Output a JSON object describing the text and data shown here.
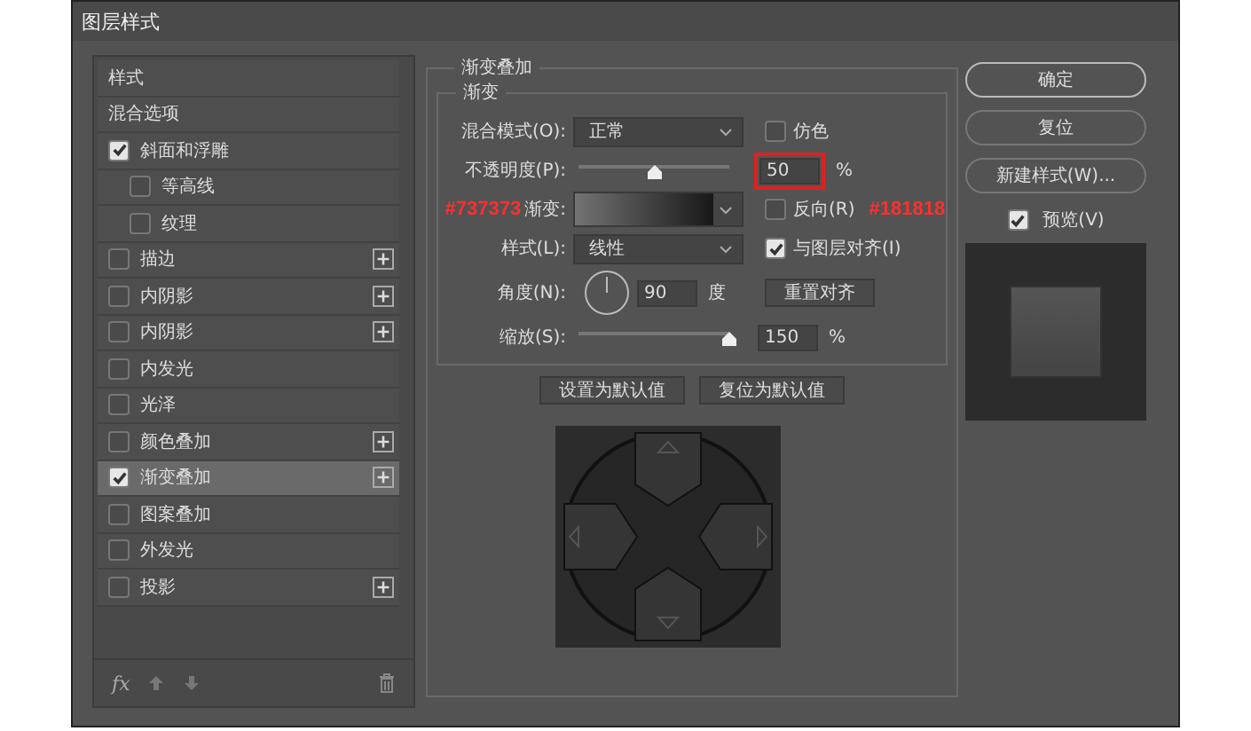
{
  "window": {
    "title": "图层样式"
  },
  "styles": {
    "items": [
      {
        "label": "样式",
        "kind": "header",
        "selected": false
      },
      {
        "label": "混合选项",
        "kind": "header",
        "selected": false
      },
      {
        "label": "斜面和浮雕",
        "kind": "check",
        "checked": true,
        "add_button": false,
        "selected": false,
        "children": [
          {
            "label": "等高线",
            "kind": "check",
            "checked": false,
            "add_button": false,
            "selected": false
          },
          {
            "label": "纹理",
            "kind": "check",
            "checked": false,
            "add_button": false,
            "selected": false
          }
        ]
      },
      {
        "label": "描边",
        "kind": "check",
        "checked": false,
        "add_button": true,
        "selected": false
      },
      {
        "label": "内阴影",
        "kind": "check",
        "checked": false,
        "add_button": true,
        "selected": false
      },
      {
        "label": "内阴影",
        "kind": "check",
        "checked": false,
        "add_button": true,
        "selected": false
      },
      {
        "label": "内发光",
        "kind": "check",
        "checked": false,
        "add_button": false,
        "selected": false
      },
      {
        "label": "光泽",
        "kind": "check",
        "checked": false,
        "add_button": false,
        "selected": false
      },
      {
        "label": "颜色叠加",
        "kind": "check",
        "checked": false,
        "add_button": true,
        "selected": false
      },
      {
        "label": "渐变叠加",
        "kind": "check",
        "checked": true,
        "add_button": true,
        "selected": true
      },
      {
        "label": "图案叠加",
        "kind": "check",
        "checked": false,
        "add_button": false,
        "selected": false
      },
      {
        "label": "外发光",
        "kind": "check",
        "checked": false,
        "add_button": false,
        "selected": false
      },
      {
        "label": "投影",
        "kind": "check",
        "checked": false,
        "add_button": true,
        "selected": false
      }
    ],
    "footer_label": "fx"
  },
  "panel": {
    "title": "渐变叠加",
    "group_title": "渐变",
    "blend_mode": {
      "label": "混合模式(O):",
      "value": "正常"
    },
    "dither": {
      "label": "仿色",
      "checked": false
    },
    "opacity": {
      "label": "不透明度(P):",
      "level": 0.5,
      "value": "50",
      "unit": "%",
      "highlighted": true
    },
    "gradient": {
      "label": "渐变:",
      "start_note": "#737373",
      "end_note": "#181818"
    },
    "reverse": {
      "label": "反向(R)",
      "checked": false
    },
    "style": {
      "label": "样式(L):",
      "value": "线性"
    },
    "align": {
      "label": "与图层对齐(I)",
      "checked": true
    },
    "angle": {
      "label": "角度(N):",
      "value": "90",
      "unit": "度",
      "reset_button": "重置对齐"
    },
    "scale": {
      "label": "缩放(S):",
      "level": 1,
      "value": "150",
      "unit": "%"
    },
    "buttons": [
      "设置为默认值",
      "复位为默认值"
    ]
  },
  "actions": {
    "buttons": [
      "确定",
      "复位",
      "新建样式(W)..."
    ],
    "preview": {
      "label": "预览(V)",
      "checked": true
    }
  }
}
